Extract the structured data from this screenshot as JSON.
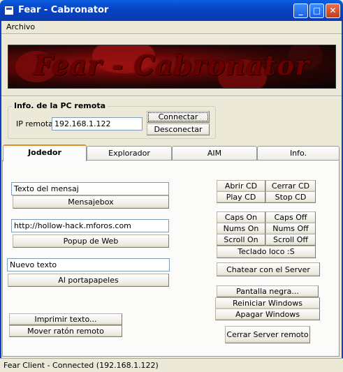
{
  "window": {
    "title": "Fear - Cabronator",
    "minimize": "_",
    "maximize": "□",
    "close": "✕"
  },
  "menu": {
    "archivo": "Archivo"
  },
  "banner": {
    "text": "Fear - Cabronator"
  },
  "remote": {
    "group_title": "Info. de la PC remota",
    "ip_label": "IP remota:",
    "ip_value": "192.168.1.122",
    "connect": "Connectar",
    "disconnect": "Desconectar"
  },
  "tabs": [
    "Jodedor",
    "Explorador",
    "AIM",
    "Info."
  ],
  "jodedor": {
    "msg_text": "Texto del mensaj",
    "msg_button": "Mensajebox",
    "url_text": "http://hollow-hack.mforos.com",
    "popup_button": "Popup de Web",
    "clip_text": "Nuevo texto",
    "clip_button": "Al portapapeles",
    "print_button": "Imprimir texto...",
    "mouse_button": "Mover ratón remoto",
    "open_cd": "Abrir CD",
    "close_cd": "Cerrar CD",
    "play_cd": "Play CD",
    "stop_cd": "Stop CD",
    "caps_on": "Caps On",
    "caps_off": "Caps Off",
    "nums_on": "Nums On",
    "nums_off": "Nums Off",
    "scroll_on": "Scroll On",
    "scroll_off": "Scroll Off",
    "crazy_kb": "Teclado loco :S",
    "chat": "Chatear con el Server",
    "black_screen": "Pantalla negra...",
    "restart": "Reiniciar Windows",
    "shutdown": "Apagar Windows",
    "close_server": "Cerrar Server remoto"
  },
  "status": {
    "text": "Fear Client - Connected (192.168.1.122)"
  }
}
